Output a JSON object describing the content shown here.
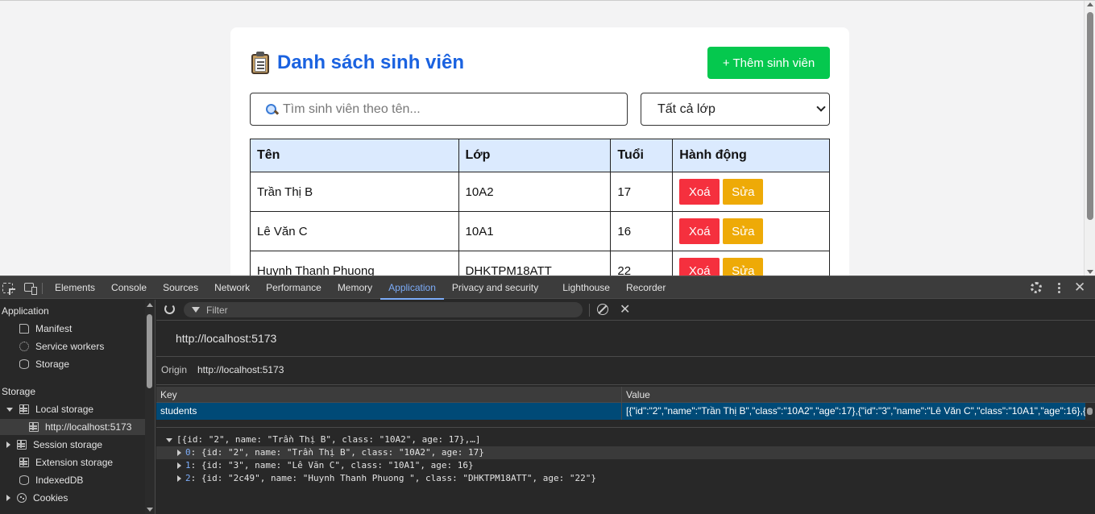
{
  "page": {
    "title": "Danh sách sinh viên",
    "add_button": "+ Thêm sinh viên",
    "search_placeholder": "Tìm sinh viên theo tên...",
    "class_filter_selected": "Tất cả lớp",
    "table": {
      "headers": [
        "Tên",
        "Lớp",
        "Tuổi",
        "Hành động"
      ],
      "rows": [
        {
          "name": "Trần Thị B",
          "class": "10A2",
          "age": "17"
        },
        {
          "name": "Lê Văn C",
          "class": "10A1",
          "age": "16"
        },
        {
          "name": "Huynh Thanh Phuong",
          "class": "DHKTPM18ATT",
          "age": "22"
        }
      ],
      "delete_label": "Xoá",
      "edit_label": "Sửa"
    }
  },
  "devtools": {
    "tabs": [
      "Elements",
      "Console",
      "Sources",
      "Network",
      "Performance",
      "Memory",
      "Application",
      "Privacy and security",
      "Lighthouse",
      "Recorder"
    ],
    "active_tab": "Application",
    "sidebar": {
      "application_heading": "Application",
      "application_items": [
        "Manifest",
        "Service workers",
        "Storage"
      ],
      "storage_heading": "Storage",
      "local_storage": "Local storage",
      "local_storage_origin": "http://localhost:5173",
      "session_storage": "Session storage",
      "extension_storage": "Extension storage",
      "indexeddb": "IndexedDB",
      "cookies": "Cookies"
    },
    "filter_placeholder": "Filter",
    "origin_title": "http://localhost:5173",
    "origin_label": "Origin",
    "origin_value": "http://localhost:5173",
    "kv_headers": {
      "key": "Key",
      "value": "Value"
    },
    "kv_row": {
      "key": "students",
      "value": "[{\"id\":\"2\",\"name\":\"Trần Thị B\",\"class\":\"10A2\",\"age\":17},{\"id\":\"3\",\"name\":\"Lê Văn C\",\"class\":\"10A1\",\"age\":16},{\"..."
    },
    "tree": {
      "root": "[{id: \"2\", name: \"Trần Thị B\", class: \"10A2\", age: 17},…]",
      "items": [
        {
          "index": "0",
          "text": ": {id: \"2\", name: \"Trần Thị B\", class: \"10A2\", age: 17}"
        },
        {
          "index": "1",
          "text": ": {id: \"3\", name: \"Lê Văn C\", class: \"10A1\", age: 16}"
        },
        {
          "index": "2",
          "text": ": {id: \"2c49\", name: \"Huynh Thanh Phuong \", class: \"DHKTPM18ATT\", age: \"22\"}"
        }
      ]
    }
  },
  "colors": {
    "title_blue": "#1a62e0",
    "add_green": "#05c84e",
    "delete_red": "#f5303e",
    "edit_amber": "#eeaa07",
    "header_blue": "#dbeafe",
    "devtools_accent": "#7cacf8"
  }
}
